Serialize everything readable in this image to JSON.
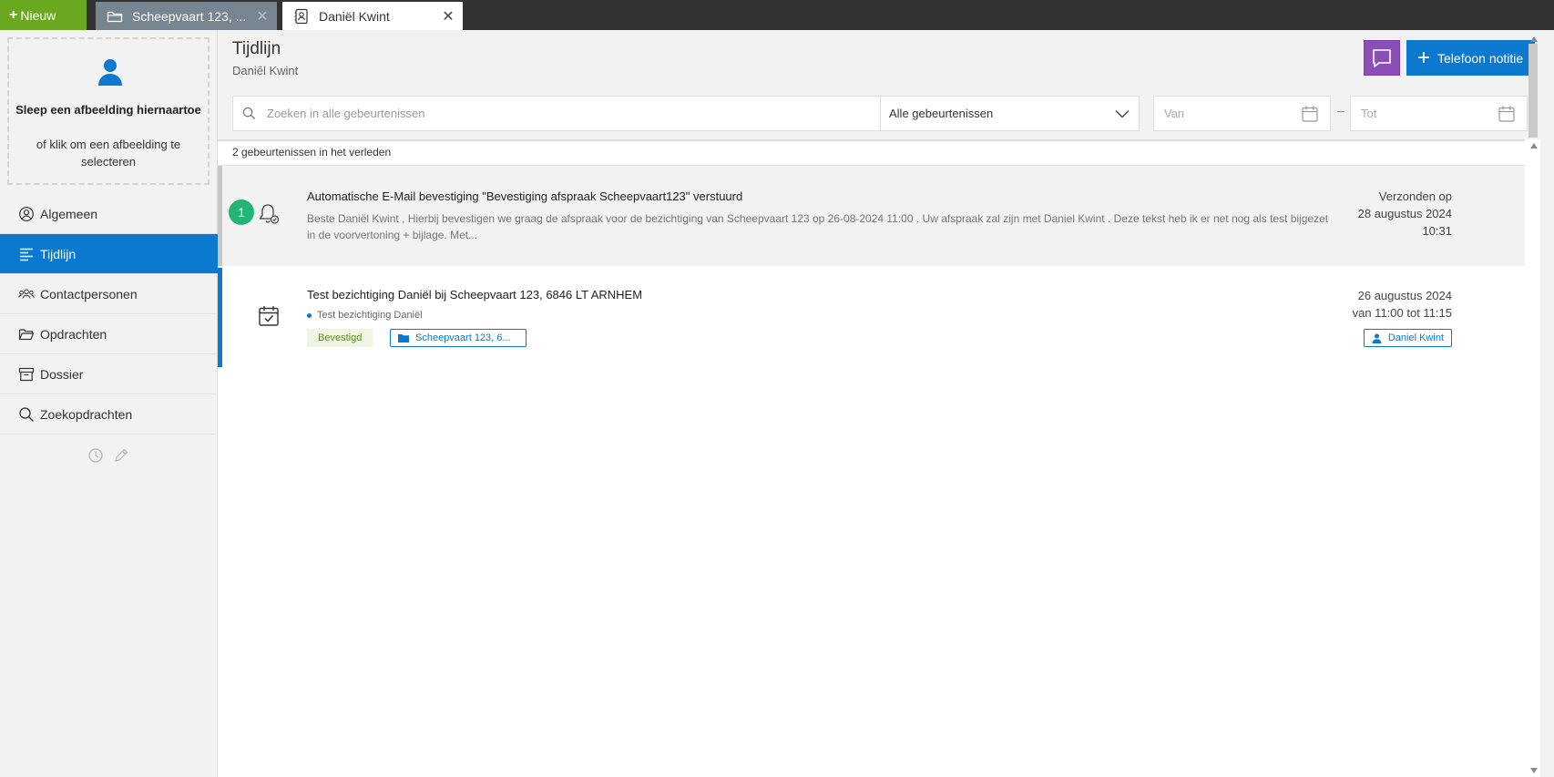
{
  "topbar": {
    "new_label": "Nieuw",
    "tabs": [
      {
        "label": "Scheepvaart 123, ...",
        "icon": "folder-icon"
      },
      {
        "label": "Daniël Kwint",
        "icon": "contact-card-icon"
      }
    ]
  },
  "sidebar": {
    "dropzone": {
      "title": "Sleep een afbeelding hiernaartoe",
      "subtitle": "of klik om een afbeelding te selecteren"
    },
    "items": [
      {
        "label": "Algemeen",
        "icon": "user-circle-icon"
      },
      {
        "label": "Tijdlijn",
        "icon": "timeline-icon",
        "active": true
      },
      {
        "label": "Contactpersonen",
        "icon": "people-icon"
      },
      {
        "label": "Opdrachten",
        "icon": "folder-open-icon"
      },
      {
        "label": "Dossier",
        "icon": "archive-icon"
      },
      {
        "label": "Zoekopdrachten",
        "icon": "search-icon"
      }
    ]
  },
  "header": {
    "title": "Tijdlijn",
    "subtitle": "Daniël Kwint",
    "phone_button": "Telefoon notitie"
  },
  "filters": {
    "search_placeholder": "Zoeken in alle gebeurtenissen",
    "event_type": "Alle gebeurtenissen",
    "from_placeholder": "Van",
    "to_placeholder": "Tot",
    "separator": "–"
  },
  "timeline": {
    "count_label": "2 gebeurtenissen in het verleden",
    "events": [
      {
        "badge": "1",
        "title": "Automatische E-Mail bevestiging \"Bevestiging afspraak Scheepvaart123\" verstuurd",
        "text": "Beste Daniël Kwint , Hierbij bevestigen we graag de afspraak voor de bezichtiging van Scheepvaart 123 op 26-08-2024 11:00 . Uw afspraak zal zijn met Daniel Kwint . Deze tekst heb ik er net nog als test bijgezet in de voorvertoning + bijlage. Met...",
        "right_line1": "Verzonden op",
        "right_line2": "28 augustus 2024",
        "right_line3": "10:31"
      },
      {
        "title": "Test bezichtiging Daniël bij Scheepvaart 123, 6846 LT ARNHEM",
        "subtitle": "Test bezichtiging Daniël",
        "status": "Bevestigd",
        "object": "Scheepvaart 123, 6...",
        "person": "Daniel Kwint",
        "right_line1": "26 augustus 2024",
        "right_line2": "van 11:00 tot 11:15"
      }
    ]
  },
  "colors": {
    "accent": "#0a79cf",
    "new_button": "#6aa820",
    "chat_button": "#8b4fb8",
    "badge": "#22b573",
    "confirmed": "#5a8f1f"
  }
}
